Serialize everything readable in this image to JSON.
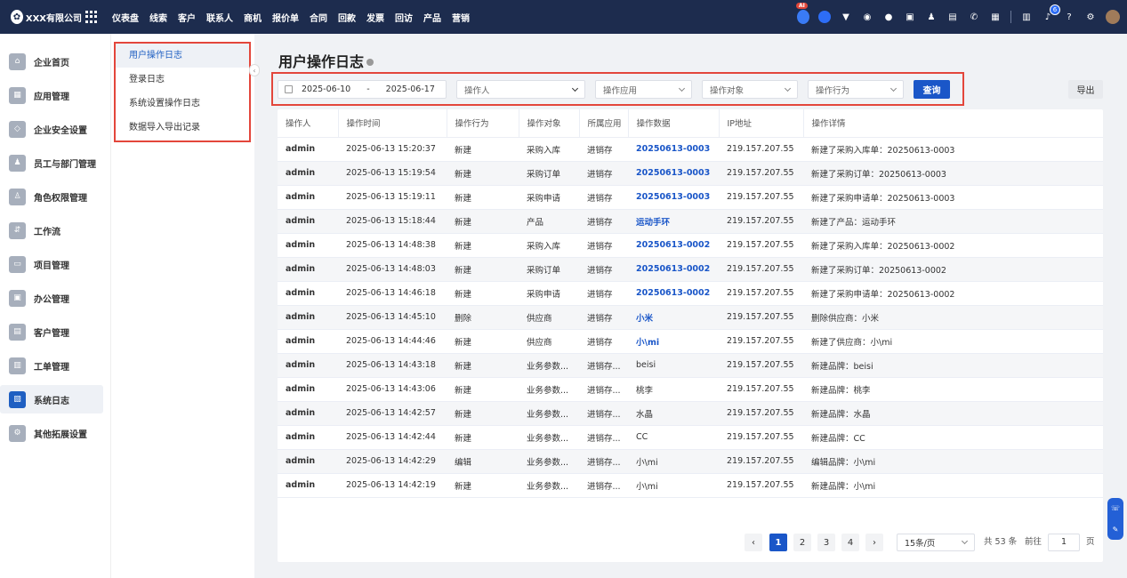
{
  "topbar": {
    "brand": "XXX有限公司",
    "nav": [
      "仪表盘",
      "线索",
      "客户",
      "联系人",
      "商机",
      "报价单",
      "合同",
      "回款",
      "发票",
      "回访",
      "产品",
      "营销"
    ],
    "ai_badge": "AI",
    "notification_count": "6"
  },
  "sidebar": {
    "items": [
      {
        "label": "企业首页",
        "icon": "home-icon"
      },
      {
        "label": "应用管理",
        "icon": "apps-icon"
      },
      {
        "label": "企业安全设置",
        "icon": "shield-icon"
      },
      {
        "label": "员工与部门管理",
        "icon": "team-icon"
      },
      {
        "label": "角色权限管理",
        "icon": "user-role-icon"
      },
      {
        "label": "工作流",
        "icon": "workflow-icon"
      },
      {
        "label": "项目管理",
        "icon": "project-icon"
      },
      {
        "label": "办公管理",
        "icon": "briefcase-icon"
      },
      {
        "label": "客户管理",
        "icon": "customer-icon"
      },
      {
        "label": "工单管理",
        "icon": "ticket-icon"
      },
      {
        "label": "系统日志",
        "icon": "log-icon"
      },
      {
        "label": "其他拓展设置",
        "icon": "settings-icon"
      }
    ],
    "active_index": 10
  },
  "submenu": {
    "items": [
      "用户操作日志",
      "登录日志",
      "系统设置操作日志",
      "数据导入导出记录"
    ],
    "active_index": 0
  },
  "page": {
    "title": "用户操作日志"
  },
  "filters": {
    "date_start": "2025-06-10",
    "date_sep": "-",
    "date_end": "2025-06-17",
    "operator_placeholder": "操作人",
    "app_placeholder": "操作应用",
    "object_placeholder": "操作对象",
    "action_placeholder": "操作行为",
    "query_label": "查询",
    "export_label": "导出"
  },
  "table": {
    "columns": [
      "操作人",
      "操作时间",
      "操作行为",
      "操作对象",
      "所属应用",
      "操作数据",
      "IP地址",
      "操作详情"
    ],
    "rows": [
      [
        "admin",
        "2025-06-13 15:20:37",
        "新建",
        "采购入库",
        "进销存",
        "20250613-0003",
        "219.157.207.55",
        "新建了采购入库单：20250613-0003"
      ],
      [
        "admin",
        "2025-06-13 15:19:54",
        "新建",
        "采购订单",
        "进销存",
        "20250613-0003",
        "219.157.207.55",
        "新建了采购订单：20250613-0003"
      ],
      [
        "admin",
        "2025-06-13 15:19:11",
        "新建",
        "采购申请",
        "进销存",
        "20250613-0003",
        "219.157.207.55",
        "新建了采购申请单：20250613-0003"
      ],
      [
        "admin",
        "2025-06-13 15:18:44",
        "新建",
        "产品",
        "进销存",
        "运动手环",
        "219.157.207.55",
        "新建了产品：运动手环"
      ],
      [
        "admin",
        "2025-06-13 14:48:38",
        "新建",
        "采购入库",
        "进销存",
        "20250613-0002",
        "219.157.207.55",
        "新建了采购入库单：20250613-0002"
      ],
      [
        "admin",
        "2025-06-13 14:48:03",
        "新建",
        "采购订单",
        "进销存",
        "20250613-0002",
        "219.157.207.55",
        "新建了采购订单：20250613-0002"
      ],
      [
        "admin",
        "2025-06-13 14:46:18",
        "新建",
        "采购申请",
        "进销存",
        "20250613-0002",
        "219.157.207.55",
        "新建了采购申请单：20250613-0002"
      ],
      [
        "admin",
        "2025-06-13 14:45:10",
        "删除",
        "供应商",
        "进销存",
        "小米",
        "219.157.207.55",
        "删除供应商：小米"
      ],
      [
        "admin",
        "2025-06-13 14:44:46",
        "新建",
        "供应商",
        "进销存",
        "小\\mi",
        "219.157.207.55",
        "新建了供应商：小\\mi"
      ],
      [
        "admin",
        "2025-06-13 14:43:18",
        "新建",
        "业务参数...",
        "进销存...",
        "beisi",
        "219.157.207.55",
        "新建品牌：beisi"
      ],
      [
        "admin",
        "2025-06-13 14:43:06",
        "新建",
        "业务参数...",
        "进销存...",
        "桃李",
        "219.157.207.55",
        "新建品牌：桃李"
      ],
      [
        "admin",
        "2025-06-13 14:42:57",
        "新建",
        "业务参数...",
        "进销存...",
        "水晶",
        "219.157.207.55",
        "新建品牌：水晶"
      ],
      [
        "admin",
        "2025-06-13 14:42:44",
        "新建",
        "业务参数...",
        "进销存...",
        "CC",
        "219.157.207.55",
        "新建品牌：CC"
      ],
      [
        "admin",
        "2025-06-13 14:42:29",
        "编辑",
        "业务参数...",
        "进销存...",
        "小\\mi",
        "219.157.207.55",
        "编辑品牌：小\\mi"
      ],
      [
        "admin",
        "2025-06-13 14:42:19",
        "新建",
        "业务参数...",
        "进销存...",
        "小\\mi",
        "219.157.207.55",
        "新建品牌：小\\mi"
      ]
    ],
    "link_rows": [
      0,
      1,
      2,
      3,
      4,
      5,
      6,
      7,
      8
    ]
  },
  "pagination": {
    "prev": "‹",
    "pages": [
      "1",
      "2",
      "3",
      "4"
    ],
    "current": "1",
    "next": "›",
    "page_size": "15条/页",
    "total": "共 53 条",
    "goto_label": "前往",
    "goto_value": "1",
    "goto_suffix": "页"
  },
  "colors": {
    "topbar": "#1d2c4e",
    "primary": "#1a56c8",
    "highlight_border": "#e3463b"
  }
}
